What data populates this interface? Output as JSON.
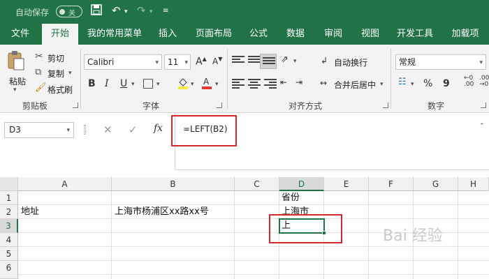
{
  "titlebar": {
    "autosave_label": "自动保存",
    "toggle_label": "关"
  },
  "tabs": [
    "文件",
    "开始",
    "我的常用菜单",
    "插入",
    "页面布局",
    "公式",
    "数据",
    "审阅",
    "视图",
    "开发工具",
    "加载项"
  ],
  "ribbon": {
    "clipboard": {
      "paste": "粘贴",
      "cut": "剪切",
      "copy": "复制",
      "format_painter": "格式刷",
      "group": "剪贴板"
    },
    "font": {
      "name": "Calibri",
      "size": "11",
      "bold": "B",
      "italic": "I",
      "underline": "U",
      "grow": "A",
      "shrink": "A",
      "group": "字体"
    },
    "alignment": {
      "wrap": "自动换行",
      "merge": "合并后居中",
      "group": "对齐方式"
    },
    "number": {
      "format": "常规",
      "percent": "%",
      "comma": "9",
      "group": "数字"
    }
  },
  "formula_bar": {
    "name_box": "D3",
    "formula": "=LEFT(B2)",
    "fx": "fx"
  },
  "grid": {
    "columns": [
      "A",
      "B",
      "C",
      "D",
      "E",
      "F",
      "G",
      "H"
    ],
    "rows": [
      "1",
      "2",
      "3",
      "4",
      "5",
      "6"
    ],
    "selected_cell": "D3",
    "cells": {
      "A2": "地址",
      "B2": "上海市杨浦区xx路xx号",
      "D1": "省份",
      "D2": "上海市",
      "D3": "上"
    }
  },
  "watermark": "Bai 经验",
  "colors": {
    "accent": "#217346",
    "highlight_box": "#d62828"
  }
}
